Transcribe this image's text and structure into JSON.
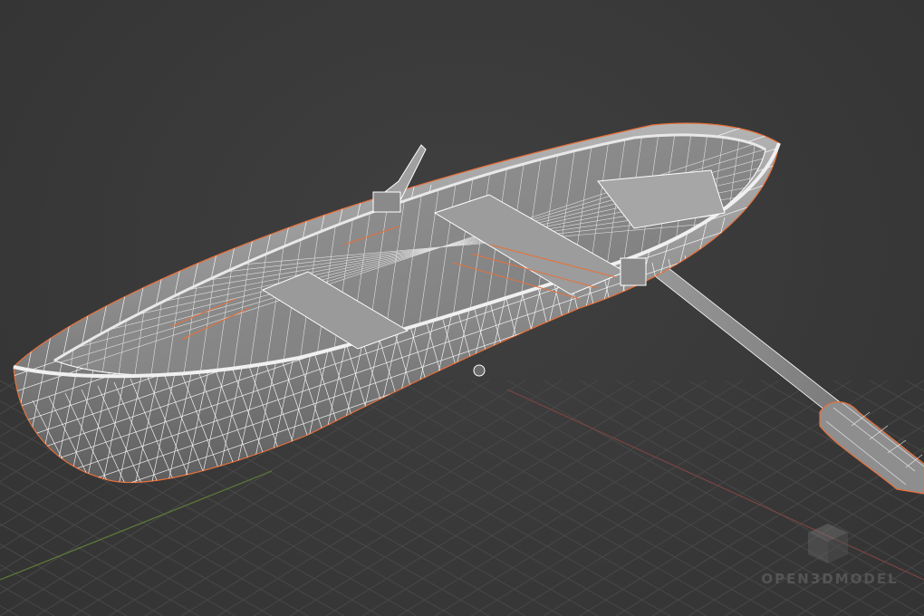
{
  "viewport": {
    "mode": "wireframe-overlay",
    "background_color": "#3a3a3a",
    "grid_color": "#484848",
    "x_axis_color": "#8a4a4a",
    "y_axis_color": "#6b8a3a"
  },
  "model": {
    "name": "rowboat",
    "surface_color": "#8f8f8f",
    "wire_color": "#ffffff",
    "edge_highlight_color": "#e8703a",
    "parts": [
      "hull",
      "thwarts",
      "oarlocks",
      "oar"
    ]
  },
  "watermark": {
    "text": "OPEN3DMODEL",
    "icon": "cube-icon"
  }
}
